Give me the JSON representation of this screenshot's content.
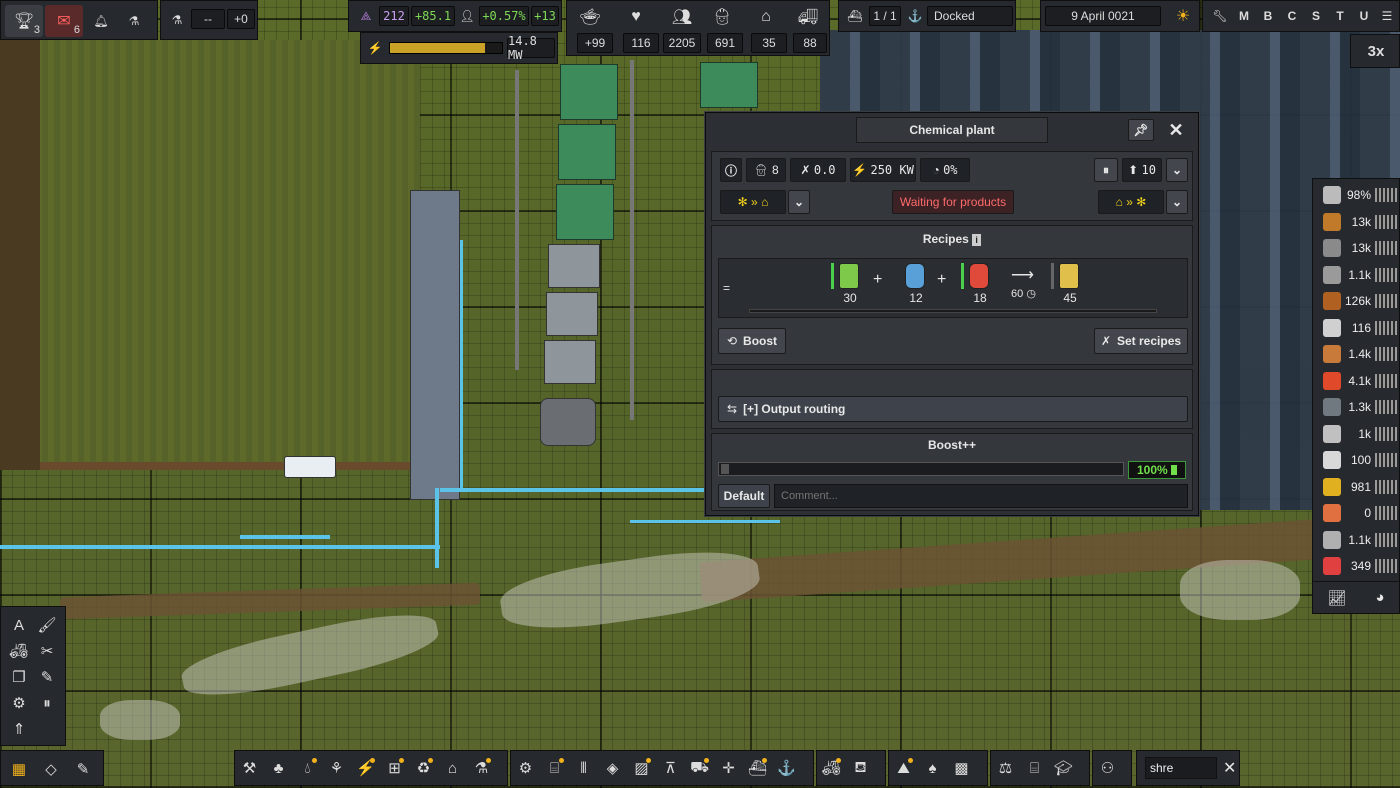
{
  "topbar": {
    "achievements_count": "3",
    "messages_count": "6",
    "research_value": "--",
    "research_delta": "+0",
    "unity_value": "212",
    "unity_delta": "+85.1",
    "population_growth": "+0.57%",
    "population_delta": "+13",
    "power_value": "14.8 MW",
    "power_fill_fraction": 0.85,
    "food_delta": "+99",
    "health_value": "116",
    "population_value": "2205",
    "workers_value": "691",
    "housing_value": "35",
    "vehicles_value": "88",
    "ships_value": "1 / 1",
    "ship_status": "Docked",
    "date": "9 April 0021",
    "speed": "3x",
    "hotkeys": [
      "M",
      "B",
      "C",
      "S",
      "T",
      "U"
    ]
  },
  "window": {
    "title": "Chemical plant",
    "workers": "8",
    "maintenance": "0.0",
    "power": "250 KW",
    "utilization": "0%",
    "priority": "10",
    "status": "Waiting for products",
    "recipes_title": "Recipes",
    "recipe": {
      "inputs": [
        {
          "qty": "30",
          "color": "#7ec84a"
        },
        {
          "qty": "12",
          "color": "#5aa0d8"
        },
        {
          "qty": "18",
          "color": "#e04a3a"
        }
      ],
      "duration": "60",
      "output": {
        "qty": "45",
        "color": "#e0c04a"
      }
    },
    "boost_label": "Boost",
    "set_recipes_label": "Set recipes",
    "output_routing_label": "[+] Output routing",
    "boostpp_title": "Boost++",
    "boostpp_percent": "100%",
    "default_label": "Default",
    "comment_placeholder": "Comment..."
  },
  "resources": [
    {
      "value": "98%",
      "color": "#bbbbbb"
    },
    {
      "value": "13k",
      "color": "#c07a2a"
    },
    {
      "value": "13k",
      "color": "#8a8a8a"
    },
    {
      "value": "1.1k",
      "color": "#9a9a9a"
    },
    {
      "value": "126k",
      "color": "#b06020"
    },
    {
      "value": "116",
      "color": "#d0d0d0"
    },
    {
      "value": "1.4k",
      "color": "#c87a3a"
    },
    {
      "value": "4.1k",
      "color": "#e04a2a"
    },
    {
      "value": "1.3k",
      "color": "#707880"
    },
    {
      "value": "1k",
      "color": "#c0c0c0"
    },
    {
      "value": "100",
      "color": "#d8d8d8"
    },
    {
      "value": "981",
      "color": "#e0b020"
    },
    {
      "value": "0",
      "color": "#e07040"
    },
    {
      "value": "1.1k",
      "color": "#b0b0b0"
    },
    {
      "value": "349",
      "color": "#e04040"
    }
  ],
  "search": {
    "value": "shre"
  }
}
